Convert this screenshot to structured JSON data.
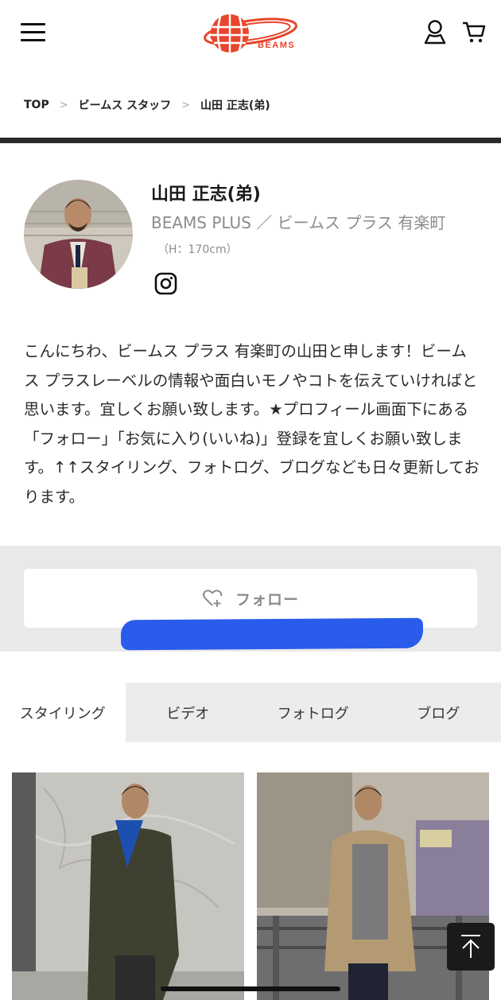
{
  "header": {
    "logo_text": "BEAMS",
    "menu_icon": "hamburger-icon",
    "user_icon": "user-icon",
    "cart_icon": "cart-icon",
    "brand_color": "#e8452c"
  },
  "breadcrumb": {
    "items": [
      "TOP",
      "ビームス スタッフ",
      "山田 正志(弟)"
    ],
    "separator": ">"
  },
  "profile": {
    "name": "山田 正志(弟)",
    "shop": "BEAMS PLUS ／ ビームス プラス 有楽町",
    "height": "（H：170cm）",
    "social_icon": "instagram-icon",
    "bio": "こんにちわ、ビームス プラス 有楽町の山田と申します！ビームス プラスレーベルの情報や面白いモノやコトを伝えていければと思います。宜しくお願い致します。★プロフィール画面下にある「フォロー」「お気に入り(いいね)」登録を宜しくお願い致します。↑↑スタイリング、フォトログ、ブログなども日々更新しております。"
  },
  "follow": {
    "label": "フォロー",
    "icon": "heart-plus-icon"
  },
  "tabs": [
    {
      "label": "スタイリング",
      "active": true
    },
    {
      "label": "ビデオ",
      "active": false
    },
    {
      "label": "フォトログ",
      "active": false
    },
    {
      "label": "ブログ",
      "active": false
    }
  ],
  "thumbnails": [
    "styling-photo-1",
    "styling-photo-2"
  ],
  "back_to_top_icon": "arrow-up-icon"
}
